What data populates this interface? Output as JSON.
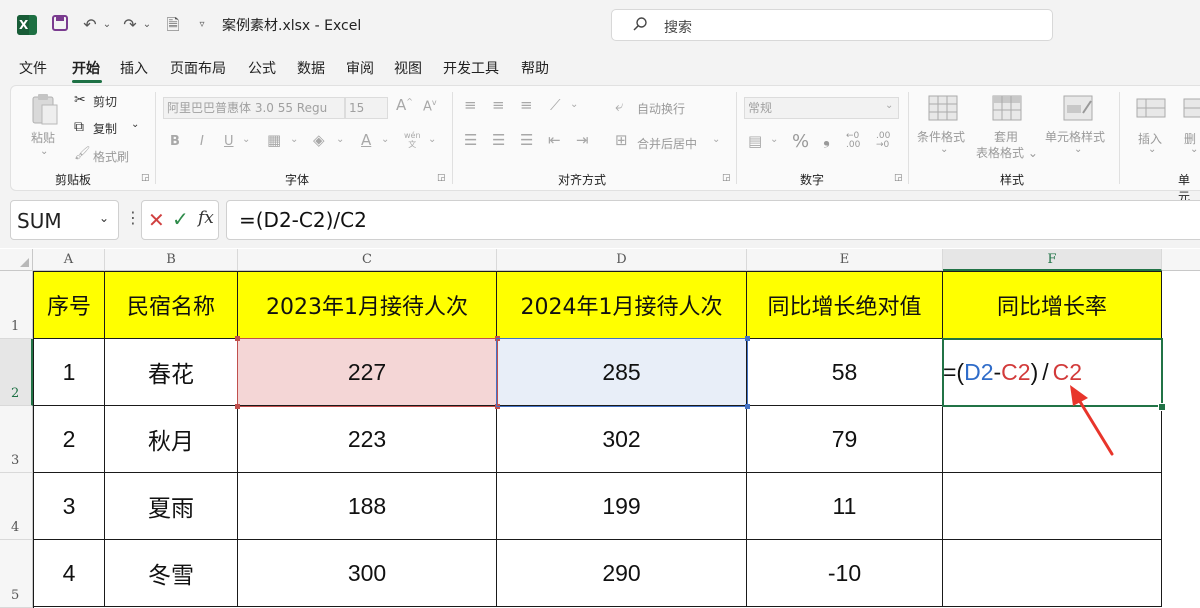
{
  "window": {
    "title": "案例素材.xlsx  -  Excel",
    "search_placeholder": "搜索"
  },
  "menu": {
    "items": [
      "文件",
      "开始",
      "插入",
      "页面布局",
      "公式",
      "数据",
      "审阅",
      "视图",
      "开发工具",
      "帮助"
    ],
    "active": "开始"
  },
  "ribbon": {
    "clipboard": {
      "paste": "粘贴",
      "cut": "剪切",
      "copy": "复制",
      "format_painter": "格式刷",
      "group": "剪贴板"
    },
    "font": {
      "font_name": "阿里巴巴普惠体 3.0 55 Regu",
      "font_size": "15",
      "bold": "B",
      "italic": "I",
      "underline": "U",
      "group": "字体",
      "wen": "wén\n文"
    },
    "alignment": {
      "wrap_text": "自动换行",
      "merge_center": "合并后居中",
      "group": "对齐方式"
    },
    "number": {
      "format": "常规",
      "group": "数字"
    },
    "styles": {
      "conditional": "条件格式",
      "table_format": "套用\n表格格式",
      "cell_styles": "单元格样式",
      "group": "样式"
    },
    "cells": {
      "insert": "插入",
      "delete": "删",
      "group": "单元"
    }
  },
  "formula_bar": {
    "name_box": "SUM",
    "fx": "fx",
    "formula": "=(D2-C2)/C2"
  },
  "sheet": {
    "columns": [
      "A",
      "B",
      "C",
      "D",
      "E",
      "F"
    ],
    "rows": [
      "1",
      "2",
      "3",
      "4",
      "5"
    ],
    "header": [
      "序号",
      "民宿名称",
      "2023年1月接待人次",
      "2024年1月接待人次",
      "同比增长绝对值",
      "同比增长率"
    ],
    "data": [
      [
        "1",
        "春花",
        "227",
        "285",
        "58",
        ""
      ],
      [
        "2",
        "秋月",
        "223",
        "302",
        "79",
        ""
      ],
      [
        "3",
        "夏雨",
        "188",
        "199",
        "11",
        ""
      ],
      [
        "4",
        "冬雪",
        "300",
        "290",
        "-10",
        ""
      ]
    ],
    "editing_cell_parts": {
      "p1": "=(",
      "d2": "D2",
      "minus": "-",
      "c2a": "C2",
      "p2": ")",
      "slash": "/",
      "c2b": "C2"
    },
    "colors": {
      "header_fill": "#ffff00",
      "ref_blue": "#2f6cc9",
      "ref_red": "#d23a3a",
      "accent_green": "#217346"
    }
  }
}
